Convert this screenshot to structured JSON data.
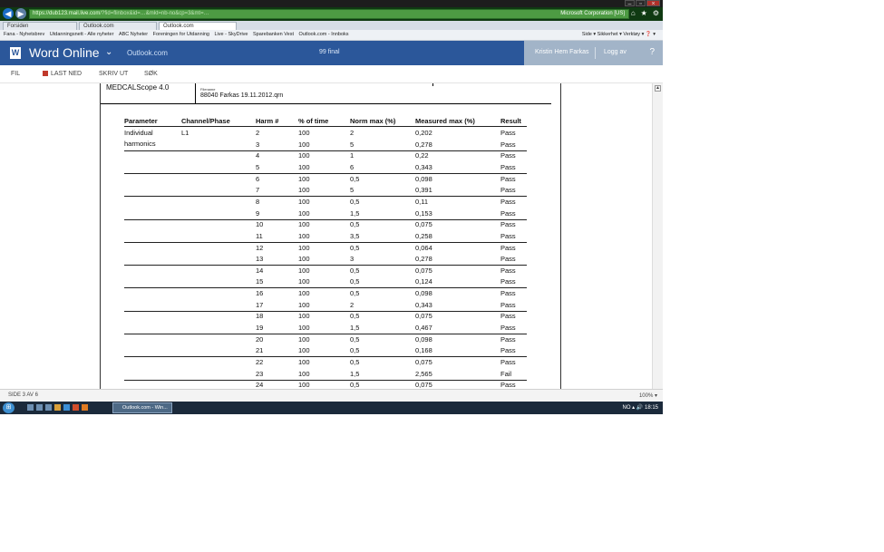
{
  "browser": {
    "address_url": "https://dub123.mail.live.com",
    "address_rest": "/?fid=flinbox&id=…&mkt=nb-no&cp=3&mt=…",
    "security_label": "Microsoft Corporation [US]",
    "tabs": [
      {
        "label": "Forsiden"
      },
      {
        "label": "Outlook.com"
      },
      {
        "label": "Outlook.com"
      }
    ],
    "favorites": [
      {
        "label": "Fana - Nyhetsbrev"
      },
      {
        "label": "Utdanningsnett - Alle nyheter"
      },
      {
        "label": "ABC Nyheter"
      },
      {
        "label": "Foreningen for Utdanning"
      },
      {
        "label": "Live - SkyDrive"
      },
      {
        "label": "Sparebanken Vest"
      },
      {
        "label": "Outlook.com - Innboks"
      }
    ],
    "favorites_right": "Side ▾   Sikkerhet ▾   Verktøy ▾   ❓ ▾"
  },
  "app": {
    "name": "Word Online",
    "outlook_link": "Outlook.com",
    "document_name": "99 final",
    "user_name": "Kristin Hem Farkas",
    "logout_label": "Logg av",
    "help_label": "?"
  },
  "ribbon": {
    "file": "FIL",
    "download": "LAST NED",
    "print": "SKRIV UT",
    "search": "SØK"
  },
  "document": {
    "software": "MEDCALScope 4.0",
    "filename_label": "Filename",
    "filename_value": "88040 Farkas 19.11.2012.qrn",
    "headers": [
      "Parameter",
      "Channel/Phase",
      "Harm #",
      "% of time",
      "Norm max (%)",
      "Measured max (%)",
      "Result"
    ],
    "param_label_1": "Individual",
    "param_label_2": "harmonics",
    "channel": "L1",
    "rows": [
      [
        "2",
        "100",
        "2",
        "0,202",
        "Pass"
      ],
      [
        "3",
        "100",
        "5",
        "0,278",
        "Pass"
      ],
      [
        "4",
        "100",
        "1",
        "0,22",
        "Pass"
      ],
      [
        "5",
        "100",
        "6",
        "0,343",
        "Pass"
      ],
      [
        "6",
        "100",
        "0,5",
        "0,098",
        "Pass"
      ],
      [
        "7",
        "100",
        "5",
        "0,391",
        "Pass"
      ],
      [
        "8",
        "100",
        "0,5",
        "0,11",
        "Pass"
      ],
      [
        "9",
        "100",
        "1,5",
        "0,153",
        "Pass"
      ],
      [
        "10",
        "100",
        "0,5",
        "0,075",
        "Pass"
      ],
      [
        "11",
        "100",
        "3,5",
        "0,258",
        "Pass"
      ],
      [
        "12",
        "100",
        "0,5",
        "0,064",
        "Pass"
      ],
      [
        "13",
        "100",
        "3",
        "0,278",
        "Pass"
      ],
      [
        "14",
        "100",
        "0,5",
        "0,075",
        "Pass"
      ],
      [
        "15",
        "100",
        "0,5",
        "0,124",
        "Pass"
      ],
      [
        "16",
        "100",
        "0,5",
        "0,098",
        "Pass"
      ],
      [
        "17",
        "100",
        "2",
        "0,343",
        "Pass"
      ],
      [
        "18",
        "100",
        "0,5",
        "0,075",
        "Pass"
      ],
      [
        "19",
        "100",
        "1,5",
        "0,467",
        "Pass"
      ],
      [
        "20",
        "100",
        "0,5",
        "0,098",
        "Pass"
      ],
      [
        "21",
        "100",
        "0,5",
        "0,168",
        "Pass"
      ],
      [
        "22",
        "100",
        "0,5",
        "0,075",
        "Pass"
      ],
      [
        "23",
        "100",
        "1,5",
        "2,565",
        "Fail"
      ],
      [
        "24",
        "100",
        "0,5",
        "0,075",
        "Pass"
      ]
    ]
  },
  "status": {
    "page_indicator": "SIDE 3 AV 6",
    "zoom": "100% ▾"
  },
  "taskbar": {
    "task_label": "Outlook.com - Win...",
    "tray": "NO  ▴  🔊  18:15"
  },
  "colors": {
    "word_blue": "#2b579a",
    "user_panel": "#a2b4c8",
    "address_green": "#4d9b43"
  }
}
